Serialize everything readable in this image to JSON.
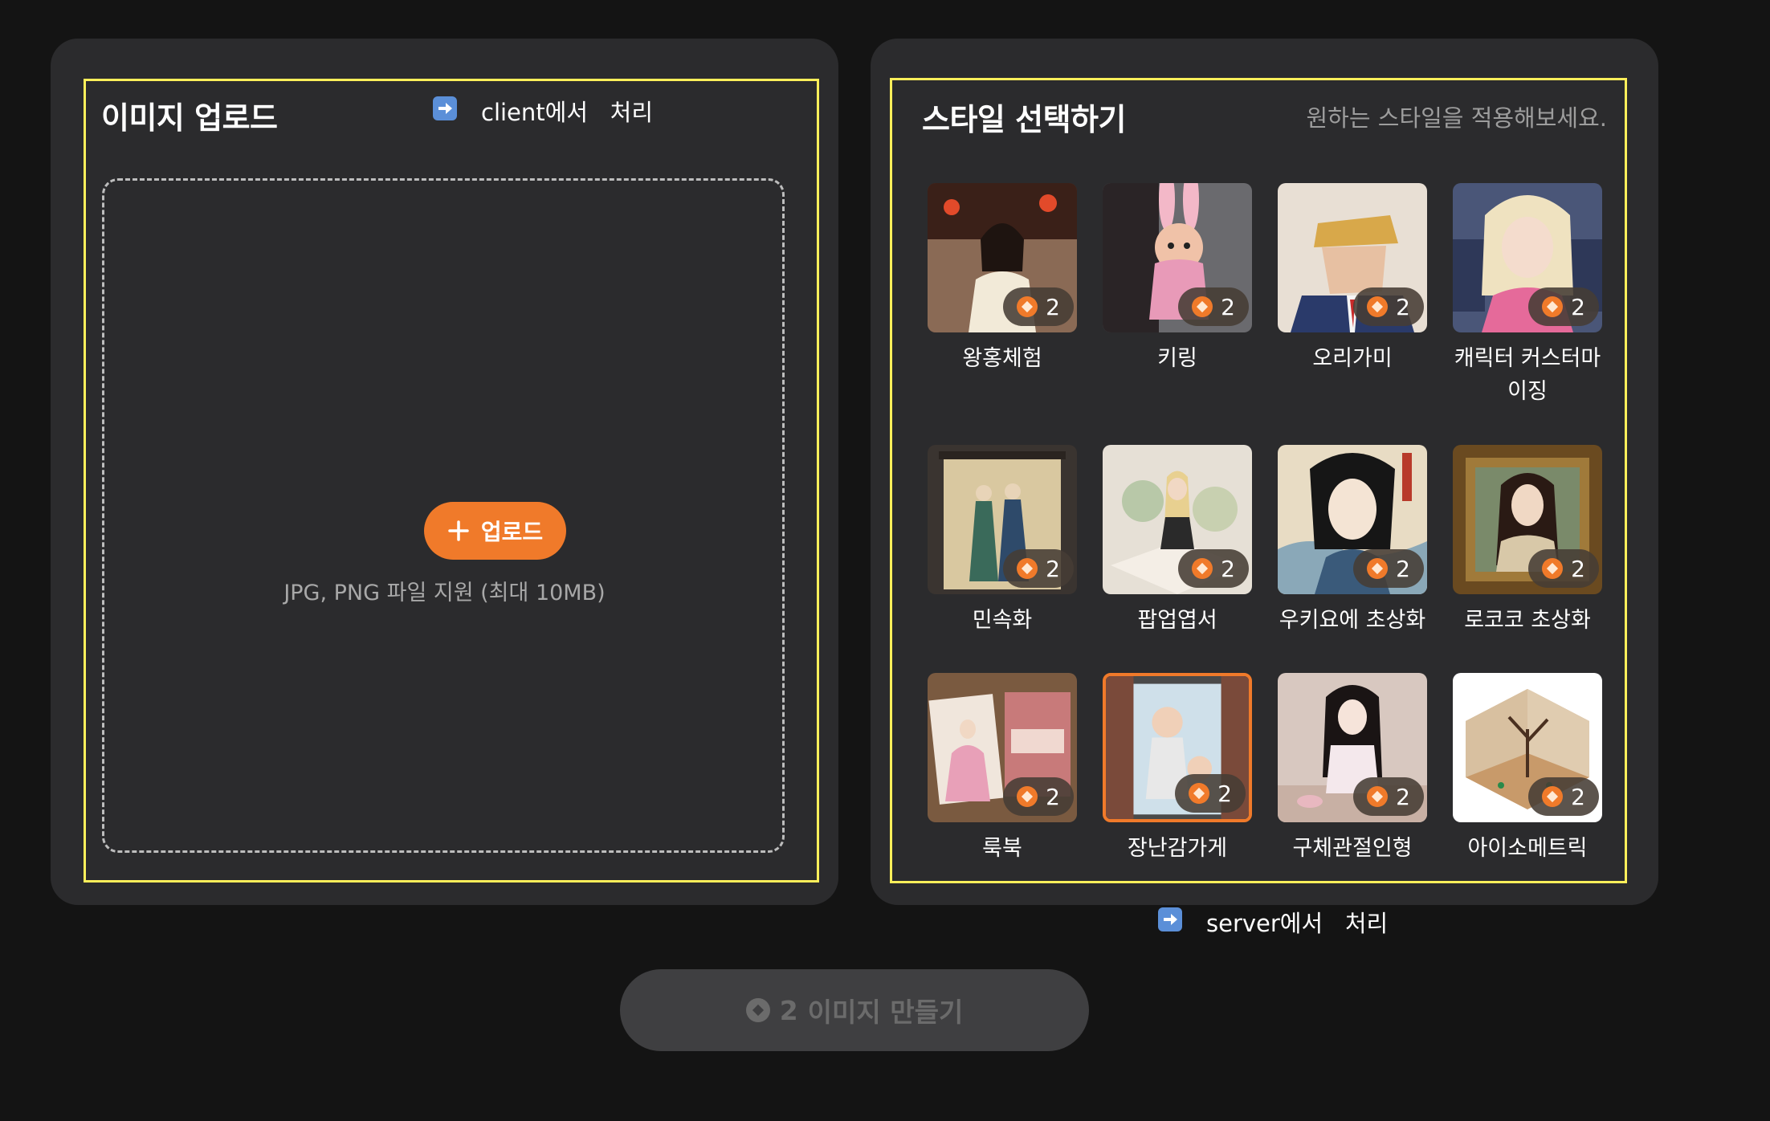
{
  "upload": {
    "title": "이미지 업로드",
    "client_note": "client에서   처리",
    "button_label": "업로드",
    "hint": "JPG, PNG 파일 지원 (최대 10MB)"
  },
  "styles": {
    "title": "스타일 선택하기",
    "subtitle": "원하는 스타일을 적용해보세요.",
    "cost": "2",
    "items": [
      {
        "label": "왕홍체험",
        "selected": false
      },
      {
        "label": "키링",
        "selected": false
      },
      {
        "label": "오리가미",
        "selected": false
      },
      {
        "label": "캐릭터 커스터마이징",
        "selected": false
      },
      {
        "label": "민속화",
        "selected": false
      },
      {
        "label": "팝업엽서",
        "selected": false
      },
      {
        "label": "우키요에 초상화",
        "selected": false
      },
      {
        "label": "로코코 초상화",
        "selected": false
      },
      {
        "label": "룩북",
        "selected": false
      },
      {
        "label": "장난감가게",
        "selected": true
      },
      {
        "label": "구체관절인형",
        "selected": false
      },
      {
        "label": "아이소메트릭",
        "selected": false
      }
    ]
  },
  "server_note": "server에서   처리",
  "make_button": {
    "cost": "2",
    "label": "이미지 만들기"
  },
  "colors": {
    "accent": "#f07a2a",
    "highlight": "#ffef5a",
    "panel": "#2b2b2d",
    "background": "#141414"
  },
  "icons": {
    "plus": "plus-icon",
    "arrow": "right-arrow-icon",
    "coin": "coin-icon"
  }
}
